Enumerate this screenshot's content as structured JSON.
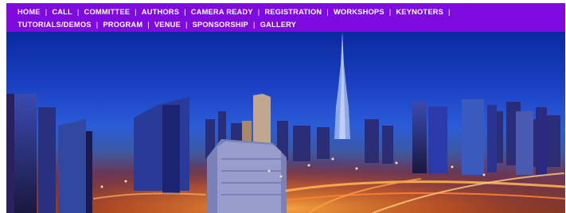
{
  "nav": {
    "row1": [
      {
        "id": "home",
        "label": "HOME"
      },
      {
        "id": "call",
        "label": "CALL"
      },
      {
        "id": "committee",
        "label": "COMMITTEE"
      },
      {
        "id": "authors",
        "label": "AUTHORS"
      },
      {
        "id": "camera-ready",
        "label": "CAMERA READY"
      },
      {
        "id": "registration",
        "label": "REGISTRATION"
      },
      {
        "id": "workshops",
        "label": "WORKSHOPS"
      },
      {
        "id": "keynoters",
        "label": "KEYNOTERS"
      }
    ],
    "row2": [
      {
        "id": "tutorials-demos",
        "label": "TUTORIALS/DEMOS"
      },
      {
        "id": "program",
        "label": "PROGRAM"
      },
      {
        "id": "venue",
        "label": "VENUE"
      },
      {
        "id": "sponsorship",
        "label": "SPONSORSHIP"
      },
      {
        "id": "gallery",
        "label": "GALLERY"
      }
    ],
    "separator": "|",
    "background": "#7e0ae0",
    "text_color": "#ffffff"
  },
  "hero": {
    "image": "dubai-skyline-night-icon"
  }
}
